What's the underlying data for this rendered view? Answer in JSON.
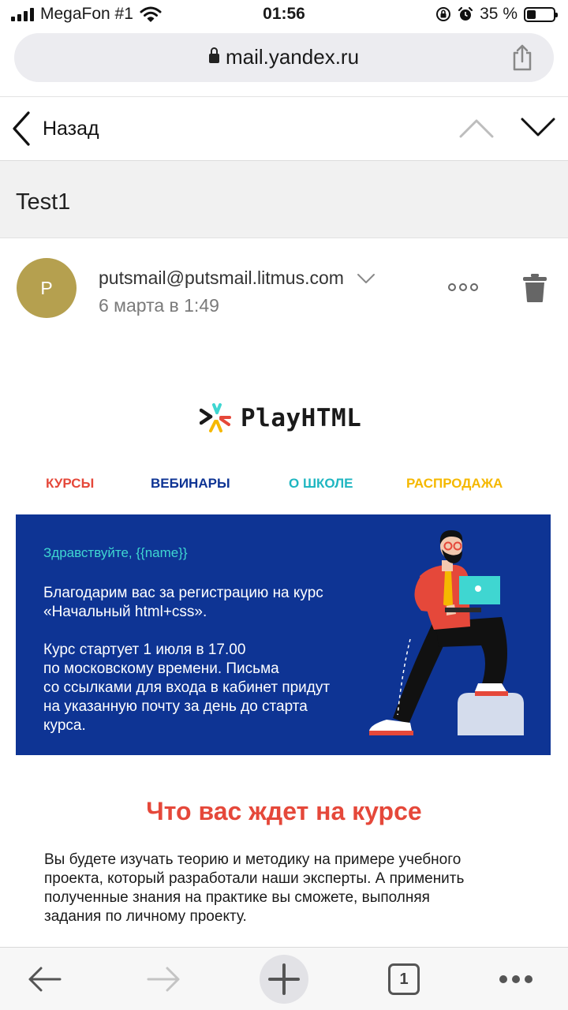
{
  "status_bar": {
    "carrier": "MegaFon #1",
    "time": "01:56",
    "battery_text": "35 %",
    "battery_level": 0.35,
    "icons": [
      "signal-icon",
      "wifi-icon",
      "orientation-lock-icon",
      "alarm-icon",
      "battery-icon"
    ]
  },
  "browser": {
    "url": "mail.yandex.ru",
    "icons": [
      "lock-icon",
      "share-icon"
    ]
  },
  "nav": {
    "back_label": "Назад",
    "icons": [
      "back-chevron-icon",
      "chevron-up-icon",
      "chevron-down-icon"
    ]
  },
  "message": {
    "subject": "Test1",
    "avatar_letter": "P",
    "avatar_color": "#b5a04f",
    "sender": "putsmail@putsmail.litmus.com",
    "date": "6 марта в 1:49"
  },
  "email": {
    "logo_text": "PlayHTML",
    "menu": [
      {
        "label": "КУРСЫ",
        "color": "#e5483a"
      },
      {
        "label": "ВЕБИНАРЫ",
        "color": "#0e3494"
      },
      {
        "label": "О ШКОЛЕ",
        "color": "#1fb6c1"
      },
      {
        "label": "РАСПРОДАЖА",
        "color": "#f5b800"
      }
    ],
    "hero": {
      "background": "#0e3494",
      "greeting": "Здравствуйте, {{name}}",
      "line1": "Благодарим вас за регистрацию на курс",
      "line2": "«Начальный html+css».",
      "line3": "Курс стартует 1 июля в 17.00",
      "line4": "по московскому времени. Письма",
      "line5": "со ссылками для входа в кабинет придут",
      "line6": "на указанную почту за день до старта",
      "line7": "курса."
    },
    "section_title": "Что вас ждет на курсе",
    "section_line1": "Вы будете изучать теорию и методику на примере учебного",
    "section_line2": "проекта, который разработали наши эксперты. А применить",
    "section_line3": "полученные знания на практике вы сможете, выполняя",
    "section_line4": "задания по личному проекту."
  },
  "toolbar": {
    "tab_count": "1",
    "icons": [
      "back-arrow-icon",
      "forward-arrow-icon",
      "new-tab-icon",
      "tabs-icon",
      "more-icon"
    ]
  }
}
